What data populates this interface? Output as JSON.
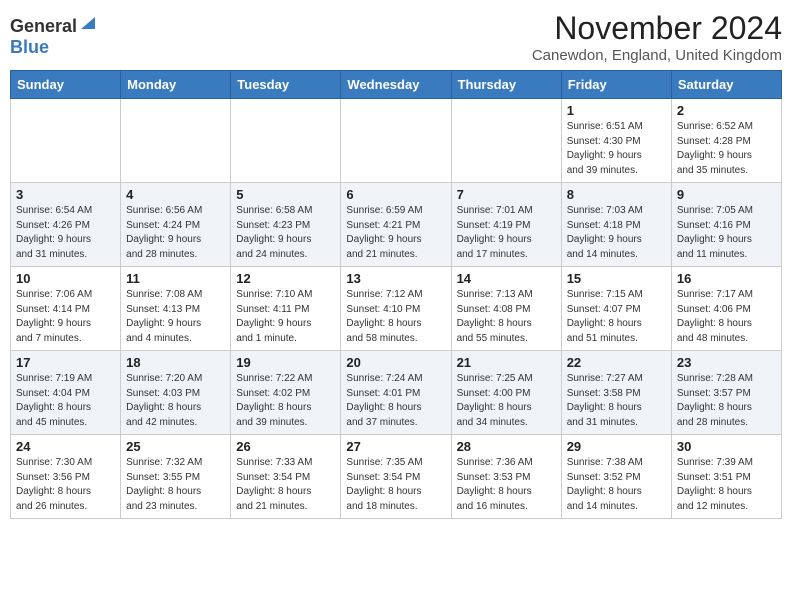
{
  "logo": {
    "general": "General",
    "blue": "Blue"
  },
  "title": {
    "month_year": "November 2024",
    "location": "Canewdon, England, United Kingdom"
  },
  "headers": [
    "Sunday",
    "Monday",
    "Tuesday",
    "Wednesday",
    "Thursday",
    "Friday",
    "Saturday"
  ],
  "weeks": [
    [
      {
        "day": "",
        "info": ""
      },
      {
        "day": "",
        "info": ""
      },
      {
        "day": "",
        "info": ""
      },
      {
        "day": "",
        "info": ""
      },
      {
        "day": "",
        "info": ""
      },
      {
        "day": "1",
        "info": "Sunrise: 6:51 AM\nSunset: 4:30 PM\nDaylight: 9 hours\nand 39 minutes."
      },
      {
        "day": "2",
        "info": "Sunrise: 6:52 AM\nSunset: 4:28 PM\nDaylight: 9 hours\nand 35 minutes."
      }
    ],
    [
      {
        "day": "3",
        "info": "Sunrise: 6:54 AM\nSunset: 4:26 PM\nDaylight: 9 hours\nand 31 minutes."
      },
      {
        "day": "4",
        "info": "Sunrise: 6:56 AM\nSunset: 4:24 PM\nDaylight: 9 hours\nand 28 minutes."
      },
      {
        "day": "5",
        "info": "Sunrise: 6:58 AM\nSunset: 4:23 PM\nDaylight: 9 hours\nand 24 minutes."
      },
      {
        "day": "6",
        "info": "Sunrise: 6:59 AM\nSunset: 4:21 PM\nDaylight: 9 hours\nand 21 minutes."
      },
      {
        "day": "7",
        "info": "Sunrise: 7:01 AM\nSunset: 4:19 PM\nDaylight: 9 hours\nand 17 minutes."
      },
      {
        "day": "8",
        "info": "Sunrise: 7:03 AM\nSunset: 4:18 PM\nDaylight: 9 hours\nand 14 minutes."
      },
      {
        "day": "9",
        "info": "Sunrise: 7:05 AM\nSunset: 4:16 PM\nDaylight: 9 hours\nand 11 minutes."
      }
    ],
    [
      {
        "day": "10",
        "info": "Sunrise: 7:06 AM\nSunset: 4:14 PM\nDaylight: 9 hours\nand 7 minutes."
      },
      {
        "day": "11",
        "info": "Sunrise: 7:08 AM\nSunset: 4:13 PM\nDaylight: 9 hours\nand 4 minutes."
      },
      {
        "day": "12",
        "info": "Sunrise: 7:10 AM\nSunset: 4:11 PM\nDaylight: 9 hours\nand 1 minute."
      },
      {
        "day": "13",
        "info": "Sunrise: 7:12 AM\nSunset: 4:10 PM\nDaylight: 8 hours\nand 58 minutes."
      },
      {
        "day": "14",
        "info": "Sunrise: 7:13 AM\nSunset: 4:08 PM\nDaylight: 8 hours\nand 55 minutes."
      },
      {
        "day": "15",
        "info": "Sunrise: 7:15 AM\nSunset: 4:07 PM\nDaylight: 8 hours\nand 51 minutes."
      },
      {
        "day": "16",
        "info": "Sunrise: 7:17 AM\nSunset: 4:06 PM\nDaylight: 8 hours\nand 48 minutes."
      }
    ],
    [
      {
        "day": "17",
        "info": "Sunrise: 7:19 AM\nSunset: 4:04 PM\nDaylight: 8 hours\nand 45 minutes."
      },
      {
        "day": "18",
        "info": "Sunrise: 7:20 AM\nSunset: 4:03 PM\nDaylight: 8 hours\nand 42 minutes."
      },
      {
        "day": "19",
        "info": "Sunrise: 7:22 AM\nSunset: 4:02 PM\nDaylight: 8 hours\nand 39 minutes."
      },
      {
        "day": "20",
        "info": "Sunrise: 7:24 AM\nSunset: 4:01 PM\nDaylight: 8 hours\nand 37 minutes."
      },
      {
        "day": "21",
        "info": "Sunrise: 7:25 AM\nSunset: 4:00 PM\nDaylight: 8 hours\nand 34 minutes."
      },
      {
        "day": "22",
        "info": "Sunrise: 7:27 AM\nSunset: 3:58 PM\nDaylight: 8 hours\nand 31 minutes."
      },
      {
        "day": "23",
        "info": "Sunrise: 7:28 AM\nSunset: 3:57 PM\nDaylight: 8 hours\nand 28 minutes."
      }
    ],
    [
      {
        "day": "24",
        "info": "Sunrise: 7:30 AM\nSunset: 3:56 PM\nDaylight: 8 hours\nand 26 minutes."
      },
      {
        "day": "25",
        "info": "Sunrise: 7:32 AM\nSunset: 3:55 PM\nDaylight: 8 hours\nand 23 minutes."
      },
      {
        "day": "26",
        "info": "Sunrise: 7:33 AM\nSunset: 3:54 PM\nDaylight: 8 hours\nand 21 minutes."
      },
      {
        "day": "27",
        "info": "Sunrise: 7:35 AM\nSunset: 3:54 PM\nDaylight: 8 hours\nand 18 minutes."
      },
      {
        "day": "28",
        "info": "Sunrise: 7:36 AM\nSunset: 3:53 PM\nDaylight: 8 hours\nand 16 minutes."
      },
      {
        "day": "29",
        "info": "Sunrise: 7:38 AM\nSunset: 3:52 PM\nDaylight: 8 hours\nand 14 minutes."
      },
      {
        "day": "30",
        "info": "Sunrise: 7:39 AM\nSunset: 3:51 PM\nDaylight: 8 hours\nand 12 minutes."
      }
    ]
  ]
}
